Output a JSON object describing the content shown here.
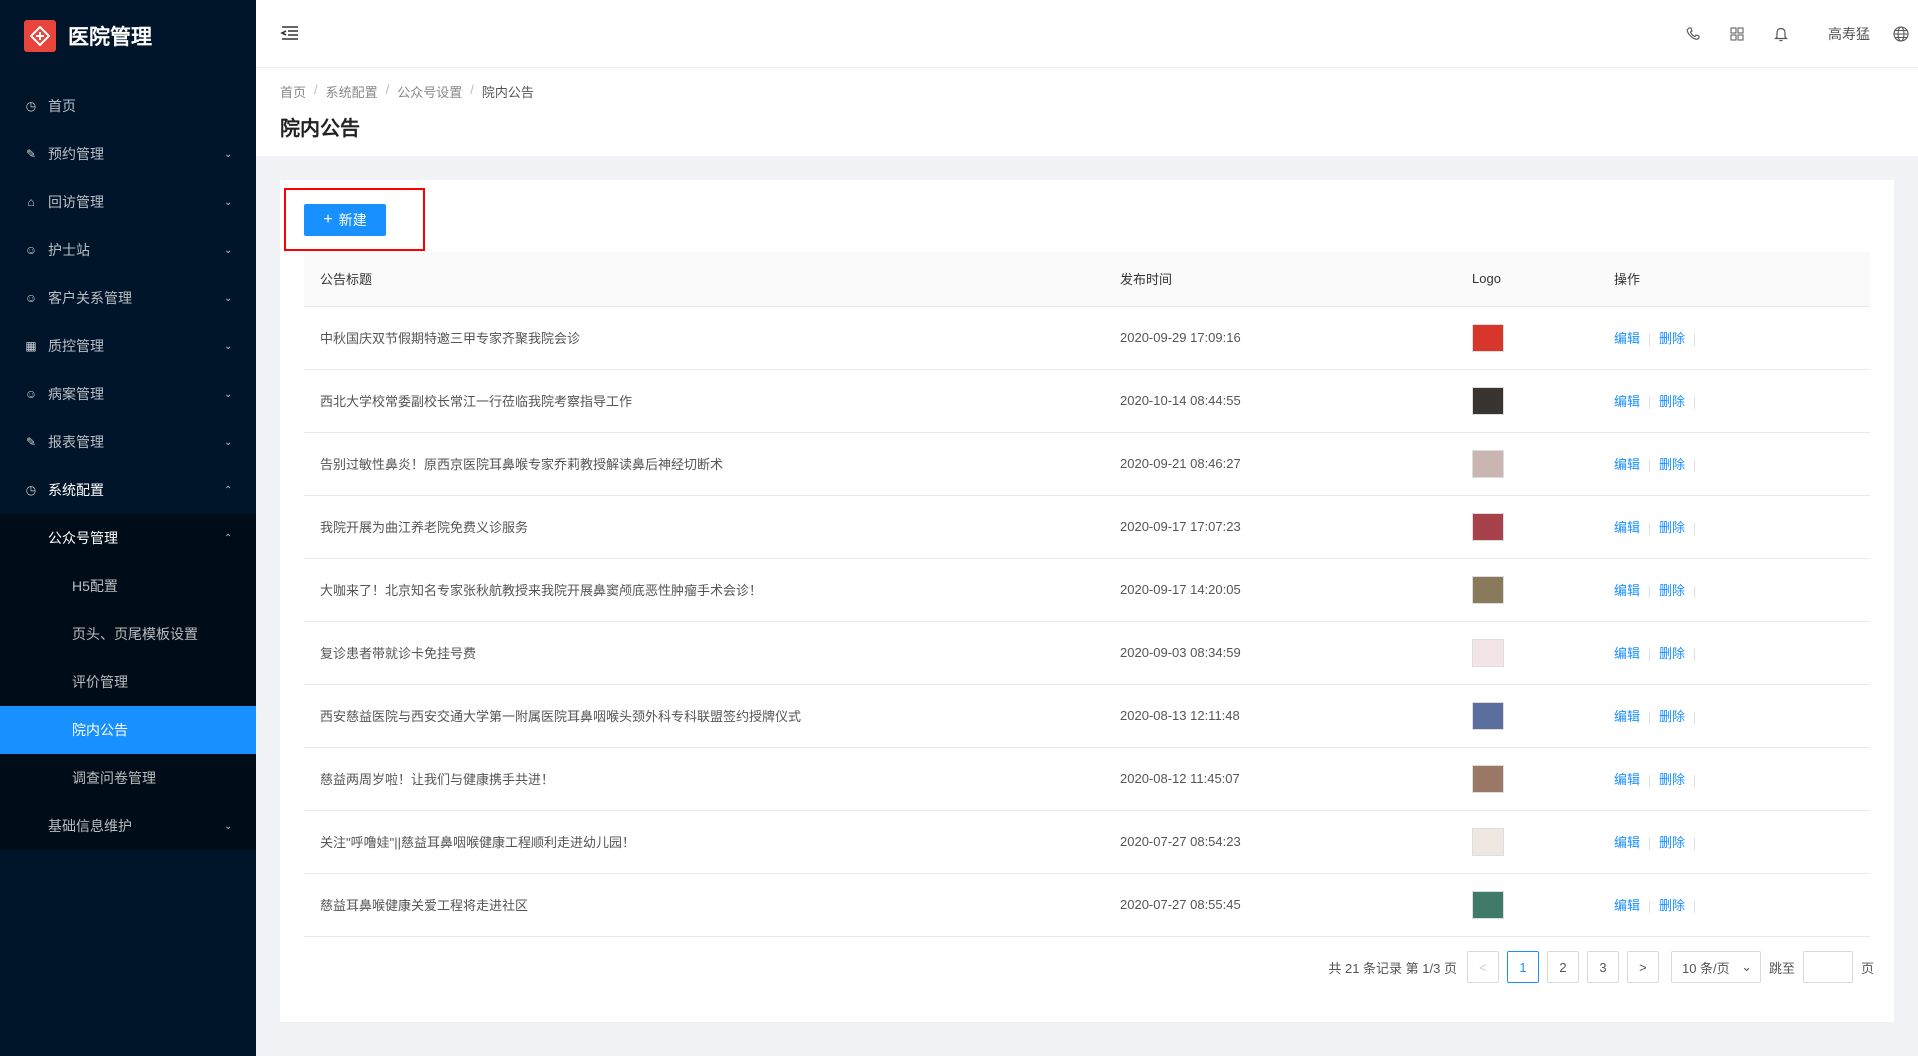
{
  "app": {
    "title": "医院管理"
  },
  "sidebar": {
    "items": [
      {
        "label": "首页",
        "icon": "dashboard-icon",
        "glyph": "◷",
        "arrow": ""
      },
      {
        "label": "预约管理",
        "icon": "edit-icon",
        "glyph": "✎",
        "arrow": "⌄"
      },
      {
        "label": "回访管理",
        "icon": "lock-icon",
        "glyph": "⌂",
        "arrow": "⌄"
      },
      {
        "label": "护士站",
        "icon": "user-icon",
        "glyph": "☺",
        "arrow": "⌄"
      },
      {
        "label": "客户关系管理",
        "icon": "user-icon",
        "glyph": "☺",
        "arrow": "⌄"
      },
      {
        "label": "质控管理",
        "icon": "table-icon",
        "glyph": "▦",
        "arrow": "⌄"
      },
      {
        "label": "病案管理",
        "icon": "user-icon",
        "glyph": "☺",
        "arrow": "⌄"
      },
      {
        "label": "报表管理",
        "icon": "edit-icon",
        "glyph": "✎",
        "arrow": "⌄"
      },
      {
        "label": "系统配置",
        "icon": "dashboard-icon",
        "glyph": "◷",
        "arrow": "⌃"
      }
    ],
    "submenu_parent": {
      "label": "公众号管理",
      "arrow": "⌃"
    },
    "submenu_items": [
      {
        "label": "H5配置"
      },
      {
        "label": "页头、页尾模板设置"
      },
      {
        "label": "评价管理"
      },
      {
        "label": "院内公告"
      },
      {
        "label": "调查问卷管理"
      }
    ],
    "last_item": {
      "label": "基础信息维护",
      "arrow": "⌄"
    }
  },
  "header": {
    "username": "高寿猛"
  },
  "breadcrumb": [
    "首页",
    "系统配置",
    "公众号设置",
    "院内公告"
  ],
  "page": {
    "title": "院内公告",
    "new_button": "新建",
    "new_plus": "+"
  },
  "table": {
    "columns": [
      "公告标题",
      "发布时间",
      "Logo",
      "操作"
    ],
    "edit_label": "编辑",
    "delete_label": "删除",
    "rows": [
      {
        "title": "中秋国庆双节假期特邀三甲专家齐聚我院会诊",
        "time": "2020-09-29 17:09:16",
        "thumb": "#d9362b"
      },
      {
        "title": "西北大学校常委副校长常江一行莅临我院考察指导工作",
        "time": "2020-10-14 08:44:55",
        "thumb": "#3a3430"
      },
      {
        "title": "告别过敏性鼻炎！原西京医院耳鼻喉专家乔莉教授解读鼻后神经切断术",
        "time": "2020-09-21 08:46:27",
        "thumb": "#c9b6b0"
      },
      {
        "title": "我院开展为曲江养老院免费义诊服务",
        "time": "2020-09-17 17:07:23",
        "thumb": "#a8424a"
      },
      {
        "title": "大咖来了！北京知名专家张秋航教授来我院开展鼻窦颅底恶性肿瘤手术会诊！",
        "time": "2020-09-17 14:20:05",
        "thumb": "#8a7a5c"
      },
      {
        "title": "复诊患者带就诊卡免挂号费",
        "time": "2020-09-03 08:34:59",
        "thumb": "#f3e4e6"
      },
      {
        "title": "西安慈益医院与西安交通大学第一附属医院耳鼻咽喉头颈外科专科联盟签约授牌仪式",
        "time": "2020-08-13 12:11:48",
        "thumb": "#5a6f9e"
      },
      {
        "title": "慈益两周岁啦！让我们与健康携手共进！",
        "time": "2020-08-12 11:45:07",
        "thumb": "#9b7866"
      },
      {
        "title": "关注\"呼噜娃\"||慈益耳鼻咽喉健康工程顺利走进幼儿园！",
        "time": "2020-07-27 08:54:23",
        "thumb": "#efe6df"
      },
      {
        "title": "慈益耳鼻喉健康关爱工程将走进社区",
        "time": "2020-07-27 08:55:45",
        "thumb": "#3f7a6a"
      }
    ]
  },
  "pagination": {
    "summary": "共 21 条记录 第 1/3 页",
    "prev": "<",
    "next": ">",
    "pages": [
      "1",
      "2",
      "3"
    ],
    "current_page": "1",
    "page_size": "10 条/页",
    "jump_label": "跳至",
    "page_suffix": "页"
  },
  "colors": {
    "primary": "#1890ff",
    "sidebar_bg": "#001529",
    "highlight_border": "#ff0000",
    "logo_bg": "#e8453c"
  }
}
